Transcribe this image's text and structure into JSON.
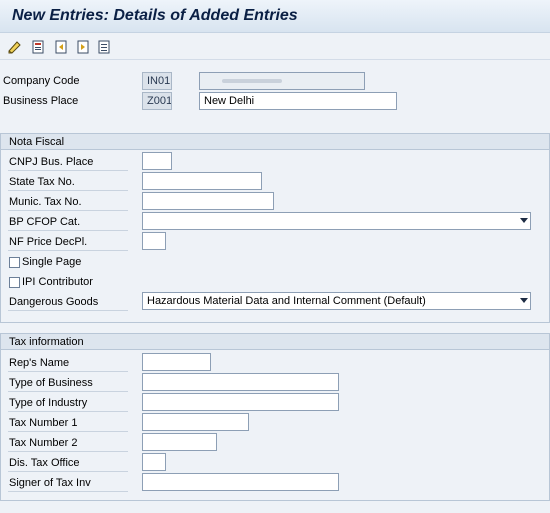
{
  "window": {
    "title": "New Entries: Details of Added Entries"
  },
  "toolbar": {
    "buttons": [
      {
        "icon": "edit-pencil-icon"
      },
      {
        "icon": "save-doc-icon"
      },
      {
        "icon": "previous-entry-icon"
      },
      {
        "icon": "next-entry-icon"
      },
      {
        "icon": "list-view-icon"
      }
    ]
  },
  "header": {
    "company_code_label": "Company Code",
    "company_code_value": "IN01",
    "company_name_value": "",
    "business_place_label": "Business Place",
    "business_place_value": "Z001",
    "business_place_name": "New Delhi"
  },
  "nota_fiscal": {
    "title": "Nota Fiscal",
    "cnpj_label": "CNPJ Bus. Place",
    "cnpj_value": "",
    "state_tax_label": "State Tax No.",
    "state_tax_value": "",
    "munic_tax_label": "Munic. Tax No.",
    "munic_tax_value": "",
    "bp_cfop_label": "BP CFOP Cat.",
    "bp_cfop_value": "",
    "nf_price_label": "NF Price DecPl.",
    "nf_price_value": "",
    "single_page_label": "Single Page",
    "single_page_checked": false,
    "ipi_label": "IPI Contributor",
    "ipi_checked": false,
    "dangerous_goods_label": "Dangerous Goods",
    "dangerous_goods_value": "Hazardous Material Data and Internal Comment (Default)"
  },
  "tax_info": {
    "title": "Tax information",
    "reps_name_label": "Rep's Name",
    "reps_name_value": "",
    "type_business_label": "Type of Business",
    "type_business_value": "",
    "type_industry_label": "Type of Industry",
    "type_industry_value": "",
    "tax1_label": "Tax Number 1",
    "tax1_value": "",
    "tax2_label": "Tax Number 2",
    "tax2_value": "",
    "dis_tax_label": "Dis. Tax Office",
    "dis_tax_value": "",
    "signer_label": "Signer of Tax Inv",
    "signer_value": ""
  }
}
